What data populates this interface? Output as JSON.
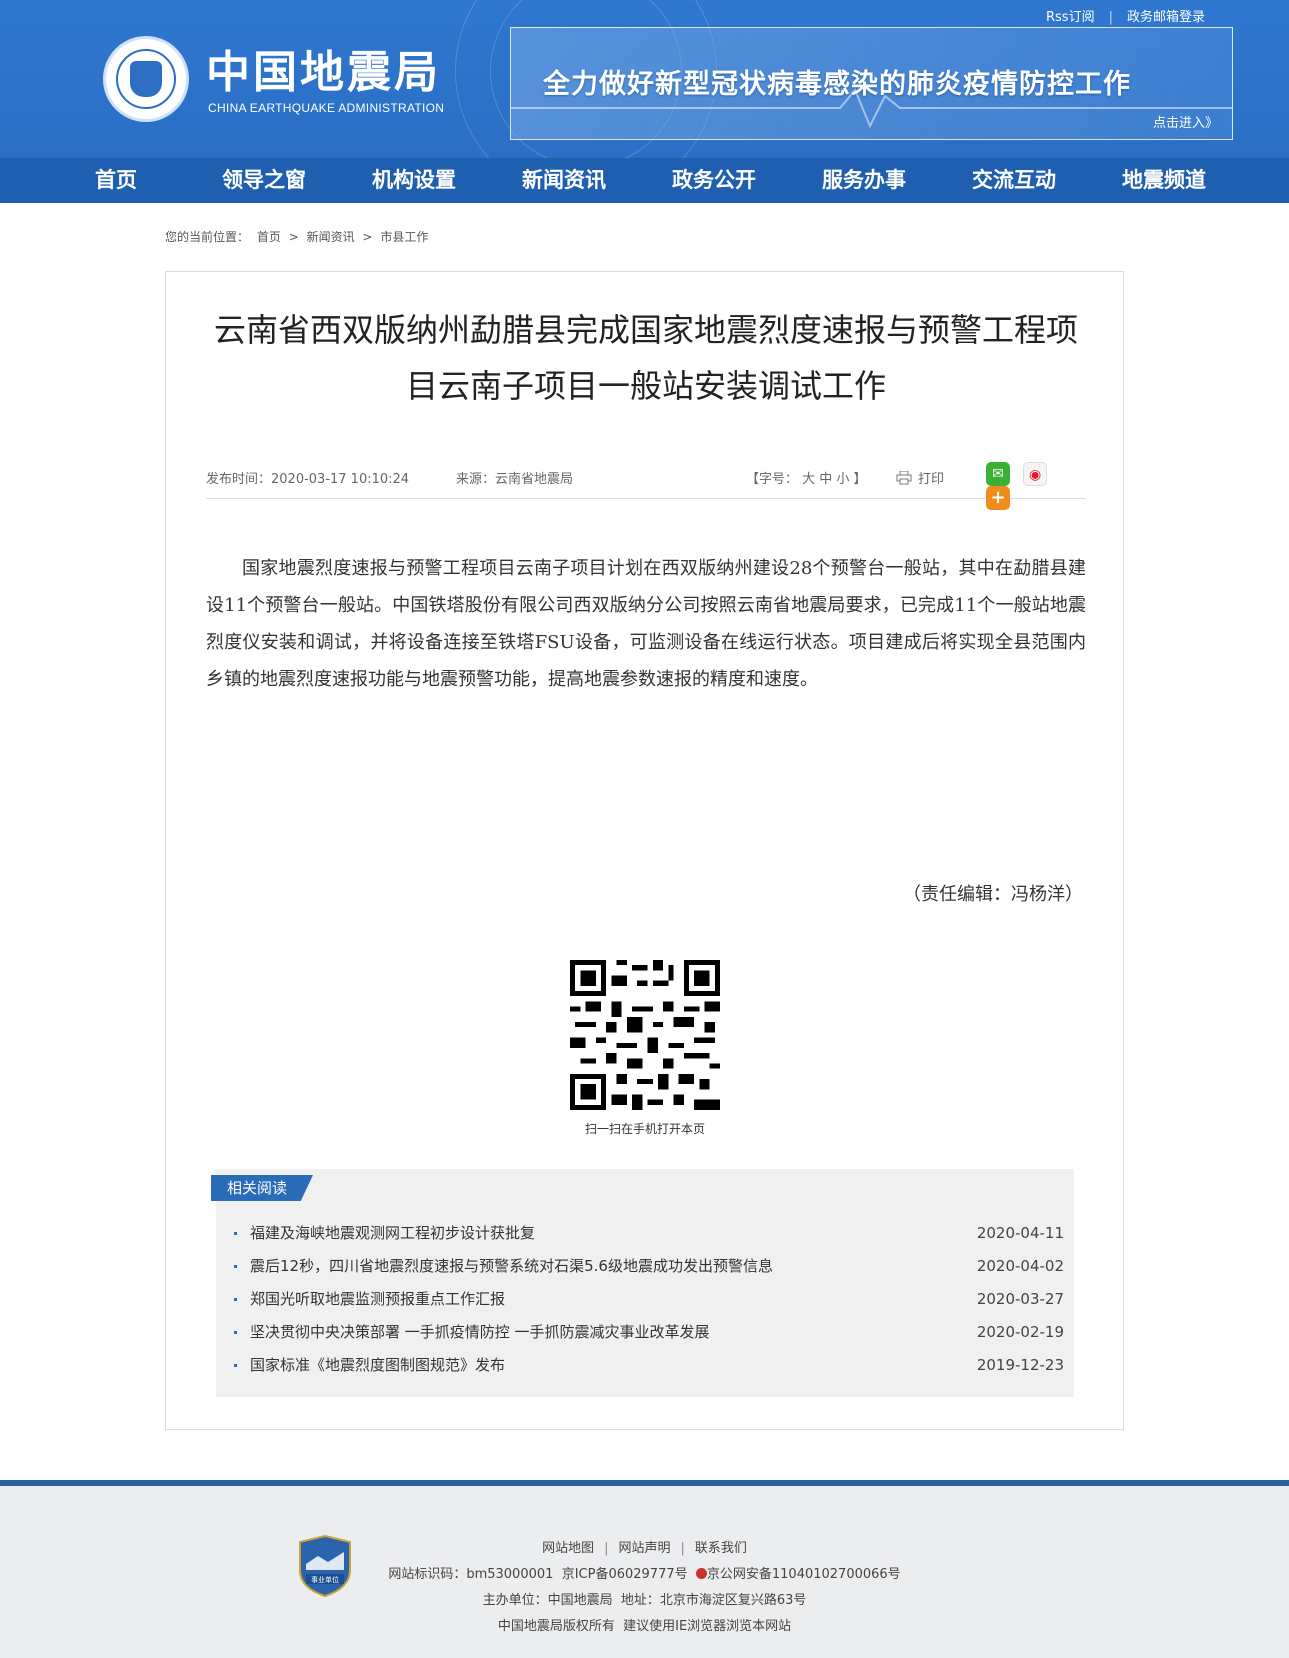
{
  "header": {
    "logo_cn": "中国地震局",
    "logo_en": "CHINA EARTHQUAKE ADMINISTRATION",
    "top_links": [
      "Rss订阅",
      "政务邮箱登录"
    ],
    "banner_title": "全力做好新型冠状病毒感染的肺炎疫情防控工作",
    "banner_more": "点击进入》"
  },
  "nav": [
    "首页",
    "领导之窗",
    "机构设置",
    "新闻资讯",
    "政务公开",
    "服务办事",
    "交流互动",
    "地震频道"
  ],
  "breadcrumb": {
    "prefix": "您的当前位置：",
    "items": [
      "首页",
      "新闻资讯",
      "市县工作"
    ],
    "sep": ">"
  },
  "article": {
    "title": "云南省西双版纳州勐腊县完成国家地震烈度速报与预警工程项目云南子项目一般站安装调试工作",
    "publish": "发布时间：2020-03-17 10:10:24",
    "source": "来源：云南省地震局",
    "font_size": "【字号： 大 中 小 】",
    "print": "打印",
    "body": "国家地震烈度速报与预警工程项目云南子项目计划在西双版纳州建设28个预警台一般站，其中在勐腊县建设11个预警台一般站。中国铁塔股份有限公司西双版纳分公司按照云南省地震局要求，已完成11个一般站地震烈度仪安装和调试，并将设备连接至铁塔FSU设备，可监测设备在线运行状态。项目建成后将实现全县范围内乡镇的地震烈度速报功能与地震预警功能，提高地震参数速报的精度和速度。",
    "editor": "（责任编辑：冯杨洋）",
    "qr_caption": "扫一扫在手机打开本页"
  },
  "share_icons": [
    "wechat-icon",
    "weibo-icon",
    "more-share-icon"
  ],
  "related": {
    "heading": "相关阅读",
    "items": [
      {
        "title": "福建及海峡地震观测网工程初步设计获批复",
        "date": "2020-04-11"
      },
      {
        "title": "震后12秒，四川省地震烈度速报与预警系统对石渠5.6级地震成功发出预警信息",
        "date": "2020-04-02"
      },
      {
        "title": "郑国光听取地震监测预报重点工作汇报",
        "date": "2020-03-27"
      },
      {
        "title": "坚决贯彻中央决策部署 一手抓疫情防控 一手抓防震减灾事业改革发展",
        "date": "2020-02-19"
      },
      {
        "title": "国家标准《地震烈度图制图规范》发布",
        "date": "2019-12-23"
      }
    ]
  },
  "footer": {
    "links": [
      "网站地图",
      "网站声明",
      "联系我们"
    ],
    "site_code": "网站标识码：bm53000001",
    "icp": "京ICP备06029777号",
    "police": "京公网安备11040102700066号",
    "host": "主办单位：中国地震局",
    "address": "地址：北京市海淀区复兴路63号",
    "copyright": "中国地震局版权所有",
    "browser_tip": "建议使用IE浏览器浏览本网站",
    "badge_text": "事业单位"
  },
  "colors": {
    "header_blue": "#2f77cf",
    "nav_blue": "#1f5faf",
    "accent": "#2b6cb8",
    "footer_border": "#2c5d9c"
  }
}
